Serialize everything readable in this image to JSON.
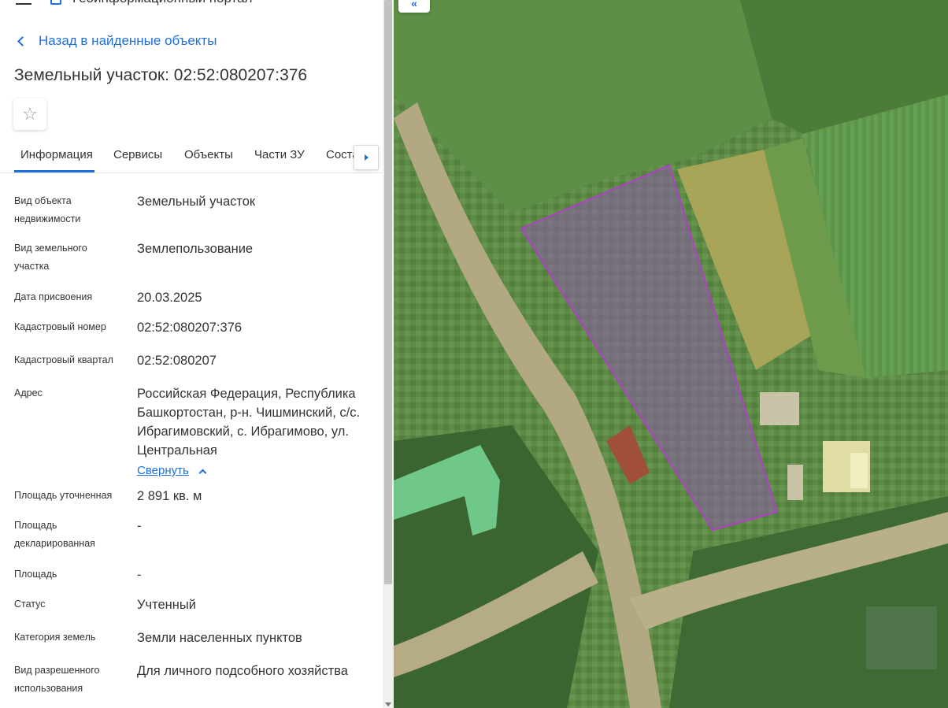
{
  "header": {
    "portal_title": "Геоинформационный портал"
  },
  "back_link": "Назад в найденные объекты",
  "page_title": "Земельный участок: 02:52:080207:376",
  "tabs": [
    {
      "label": "Информация",
      "active": true
    },
    {
      "label": "Сервисы"
    },
    {
      "label": "Объекты"
    },
    {
      "label": "Части ЗУ"
    },
    {
      "label": "Состав"
    }
  ],
  "fields": [
    {
      "label": "Вид объекта недвижимости",
      "value": "Земельный участок"
    },
    {
      "label": "Вид земельного участка",
      "value": "Землепользование"
    },
    {
      "label": "Дата присвоения",
      "value": "20.03.2025"
    },
    {
      "label": "Кадастровый номер",
      "value": "02:52:080207:376"
    },
    {
      "label": "Кадастровый квартал",
      "value": "02:52:080207"
    },
    {
      "label": "Адрес",
      "value": "Российская Федерация, Республика Башкортостан, р-н. Чишминский, с/с. Ибрагимовский, с. Ибрагимово, ул. Центральная",
      "collapse_label": "Свернуть"
    },
    {
      "label": "Площадь уточненная",
      "value": "2 891 кв. м"
    },
    {
      "label": "Площадь декларированная",
      "value": "-"
    },
    {
      "label": "Площадь",
      "value": "-"
    },
    {
      "label": "Статус",
      "value": "Учтенный"
    },
    {
      "label": "Категория земель",
      "value": "Земли населенных пунктов"
    },
    {
      "label": "Вид разрешенного использования",
      "value": "Для личного подсобного хозяйства"
    }
  ],
  "map": {
    "toggle_label": "«",
    "parcel_outline_color": "#b23ec9"
  }
}
